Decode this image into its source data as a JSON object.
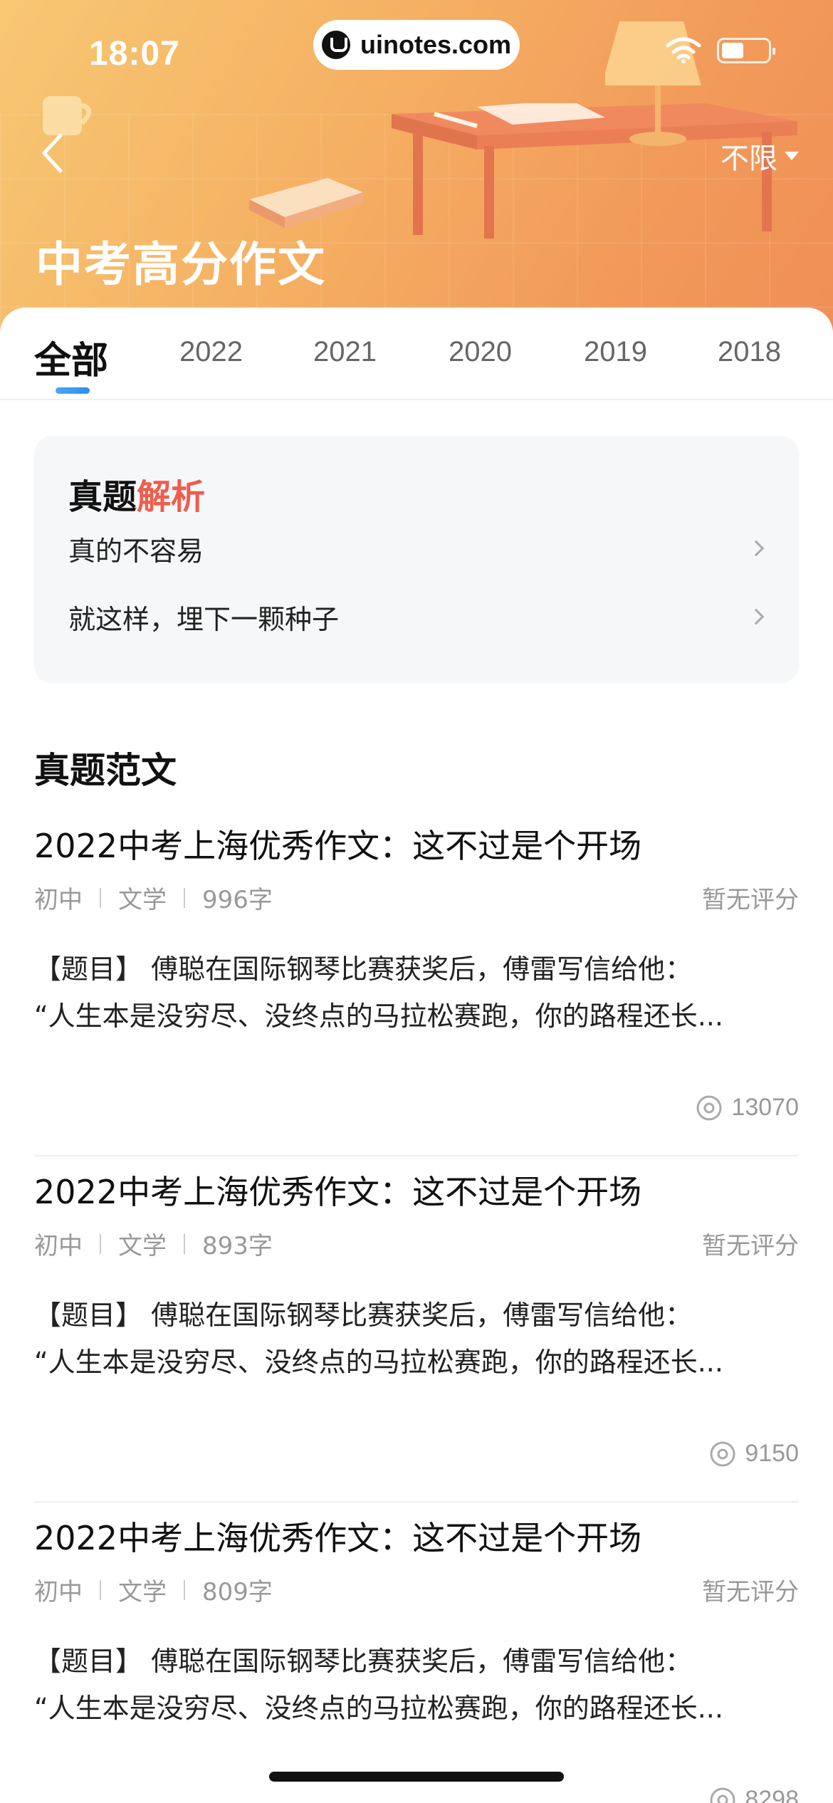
{
  "status_bar": {
    "time": "18:07",
    "watermark": "uinotes.com"
  },
  "header": {
    "title": "中考高分作文",
    "filter_label": "不限"
  },
  "tabs": [
    {
      "label": "全部",
      "active": true
    },
    {
      "label": "2022"
    },
    {
      "label": "2021"
    },
    {
      "label": "2020"
    },
    {
      "label": "2019"
    },
    {
      "label": "2018"
    }
  ],
  "analysis": {
    "heading_main": "真题",
    "heading_accent": "解析",
    "items": [
      {
        "label": "真的不容易"
      },
      {
        "label": "就这样，埋下一颗种子"
      }
    ]
  },
  "essays": {
    "section_title": "真题范文",
    "items": [
      {
        "title": "2022中考上海优秀作文：这不过是个开场",
        "level": "初中",
        "genre": "文学",
        "words": "996字",
        "rating": "暂无评分",
        "excerpt_line1": "【题目】 傅聪在国际钢琴比赛获奖后，傅雷写信给他：",
        "excerpt_line2": "“人生本是没穷尽、没终点的马拉松赛跑，你的路程还长...",
        "views": "13070"
      },
      {
        "title": "2022中考上海优秀作文：这不过是个开场",
        "level": "初中",
        "genre": "文学",
        "words": "893字",
        "rating": "暂无评分",
        "excerpt_line1": "【题目】 傅聪在国际钢琴比赛获奖后，傅雷写信给他：",
        "excerpt_line2": "“人生本是没穷尽、没终点的马拉松赛跑，你的路程还长...",
        "views": "9150"
      },
      {
        "title": "2022中考上海优秀作文：这不过是个开场",
        "level": "初中",
        "genre": "文学",
        "words": "809字",
        "rating": "暂无评分",
        "excerpt_line1": "【题目】 傅聪在国际钢琴比赛获奖后，傅雷写信给他：",
        "excerpt_line2": "“人生本是没穷尽、没终点的马拉松赛跑，你的路程还长...",
        "views": "8298"
      }
    ]
  },
  "colors": {
    "accent_red": "#ee5d4d",
    "tab_indicator": "#2f8ef0",
    "hero_orange": "#f5b163"
  }
}
